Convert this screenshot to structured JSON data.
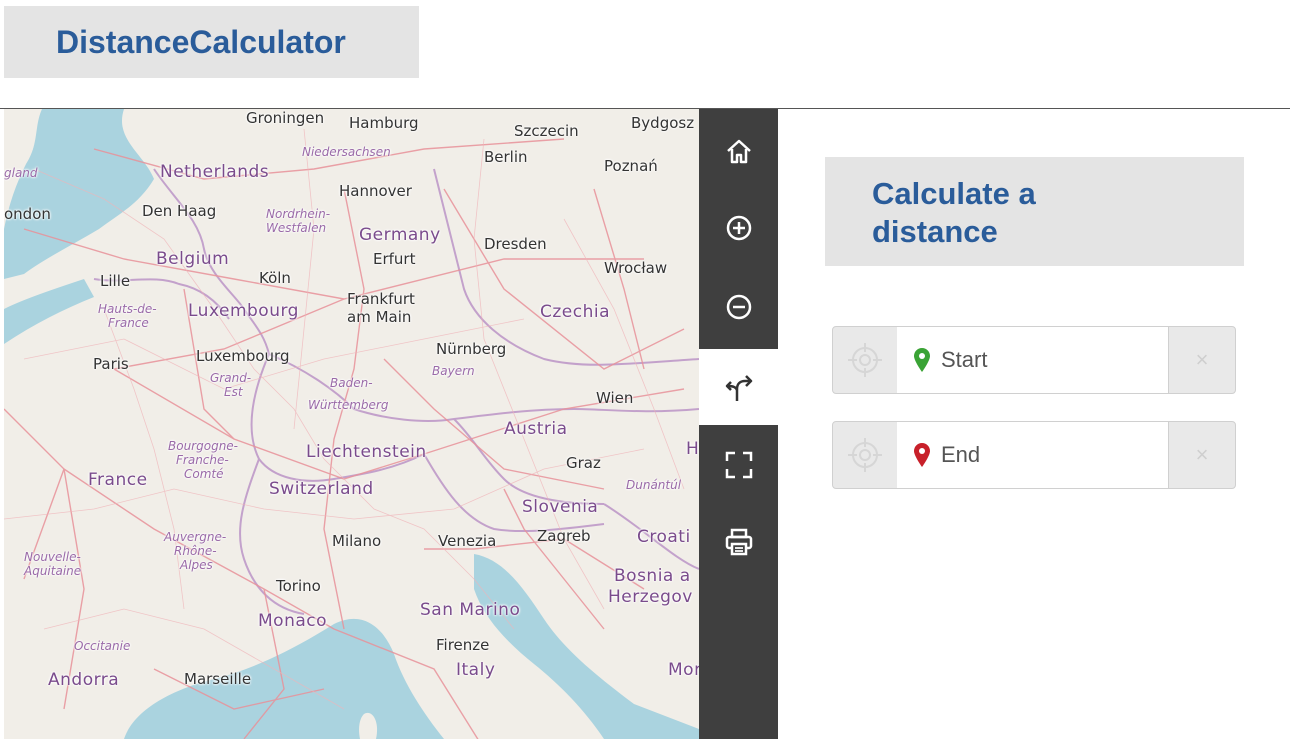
{
  "app": {
    "title": "DistanceCalculator"
  },
  "map": {
    "countries": [
      "Netherlands",
      "Belgium",
      "Luxembourg",
      "Germany",
      "Czechia",
      "Austria",
      "Liechtenstein",
      "Switzerland",
      "France",
      "Slovenia",
      "Croatia",
      "Bosnia and Herzegovina",
      "Monaco",
      "San Marino",
      "Italy",
      "Andorra"
    ],
    "cities": [
      "Groningen",
      "Hamburg",
      "Szczecin",
      "Bydgoszcz",
      "Berlin",
      "Poznań",
      "Hannover",
      "London",
      "Den Haag",
      "Dresden",
      "Wrocław",
      "Lille",
      "Köln",
      "Erfurt",
      "Frankfurt am Main",
      "Paris",
      "Luxembourg",
      "Nürnberg",
      "Wien",
      "Graz",
      "Zagreb",
      "Milano",
      "Venezia",
      "Torino",
      "Firenze",
      "Marseille"
    ],
    "regions": [
      "Niedersachsen",
      "Nordrhein-Westfalen",
      "Hauts-de-France",
      "Grand-Est",
      "Baden-Württemberg",
      "Bayern",
      "Bourgogne-Franche-Comté",
      "Auvergne-Rhône-Alpes",
      "Nouvelle-Aquitaine",
      "Occitanie",
      "Dunántúl"
    ],
    "labels": {
      "groningen": "Groningen",
      "hamburg": "Hamburg",
      "szczecin": "Szczecin",
      "bydgoszcz": "Bydgosz",
      "niedersachsen": "Niedersachsen",
      "berlin": "Berlin",
      "poznan": "Poznań",
      "netherlands": "Netherlands",
      "hannover": "Hannover",
      "england": "gland",
      "london": "ondon",
      "denhaag": "Den Haag",
      "nrw1": "Nordrhein-",
      "nrw2": "Westfalen",
      "germany": "Germany",
      "dresden": "Dresden",
      "belgium": "Belgium",
      "erfurt": "Erfurt",
      "wroclaw": "Wrocław",
      "lille": "Lille",
      "koln": "Köln",
      "hdf1": "Hauts-de-",
      "hdf2": "France",
      "luxembourg_c": "Luxembourg",
      "frankfurt1": "Frankfurt",
      "frankfurt2": "am Main",
      "czechia": "Czechia",
      "nurnberg": "Nürnberg",
      "paris": "Paris",
      "luxembourg_city": "Luxembourg",
      "bayern": "Bayern",
      "grandest1": "Grand-",
      "grandest2": "Est",
      "bw1": "Baden-",
      "bw2": "Württemberg",
      "wien": "Wien",
      "austria": "Austria",
      "bfc1": "Bourgogne-",
      "bfc2": "Franche-",
      "bfc3": "Comté",
      "liechtenstein": "Liechtenstein",
      "graz": "Graz",
      "france": "France",
      "switzerland": "Switzerland",
      "dunantul": "Dunántúl",
      "slovenia": "Slovenia",
      "ara1": "Auvergne-",
      "ara2": "Rhône-",
      "ara3": "Alpes",
      "milano": "Milano",
      "venezia": "Venezia",
      "zagreb": "Zagreb",
      "croatia": "Croati",
      "na1": "Nouvelle-",
      "na2": "Aquitaine",
      "torino": "Torino",
      "bosnia1": "Bosnia a",
      "bosnia2": "Herzegov",
      "monaco": "Monaco",
      "sanmarino": "San Marino",
      "occitanie": "Occitanie",
      "firenze": "Firenze",
      "andorra": "Andorra",
      "marseille": "Marseille",
      "italy": "Italy",
      "mor": "Mor",
      "h1": "H",
      "h2": "H"
    }
  },
  "toolbar": {
    "buttons": [
      {
        "name": "home-icon",
        "active": false
      },
      {
        "name": "zoom-in-icon",
        "active": false
      },
      {
        "name": "zoom-out-icon",
        "active": false
      },
      {
        "name": "route-icon",
        "active": true
      },
      {
        "name": "fullscreen-icon",
        "active": false
      },
      {
        "name": "print-icon",
        "active": false
      }
    ]
  },
  "panel": {
    "title": "Calculate a distance",
    "start": {
      "placeholder": "Start",
      "value": "",
      "marker_color": "#3aa335"
    },
    "end": {
      "placeholder": "End",
      "value": "",
      "marker_color": "#c8202a"
    },
    "clear_label": "×"
  }
}
